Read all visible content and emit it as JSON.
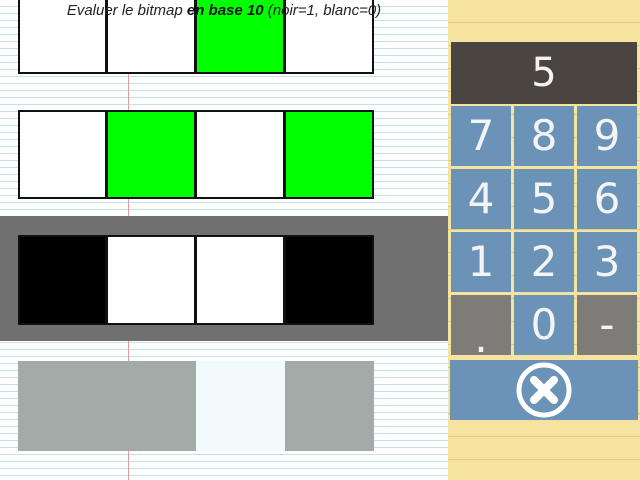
{
  "instruction": {
    "part1": "Evaluer le bitmap ",
    "part2": "en base 10",
    "part3": " (noir=1, blanc=0)"
  },
  "bitmap_rows": [
    {
      "cells": [
        "white",
        "white",
        "green",
        "white"
      ]
    },
    {
      "cells": [
        "white",
        "green",
        "white",
        "green"
      ]
    },
    {
      "cells": [
        "black",
        "white",
        "white",
        "black"
      ],
      "selected": true
    },
    {
      "cells": [
        "gray",
        "gray",
        "white",
        "gray"
      ],
      "faded": true
    }
  ],
  "colors": {
    "green": "#00ff00",
    "black": "#000000",
    "white": "#ffffff",
    "gray": "#a3aaa8",
    "key_blue": "#6a93b7",
    "key_gray": "#7d7c79",
    "display_bg": "#4a4541"
  },
  "keypad": {
    "display_value": "5",
    "keys": [
      "7",
      "8",
      "9",
      "4",
      "5",
      "6",
      "1",
      "2",
      "3",
      ".",
      "0",
      "-"
    ],
    "clear_icon": "close-circle-icon"
  }
}
